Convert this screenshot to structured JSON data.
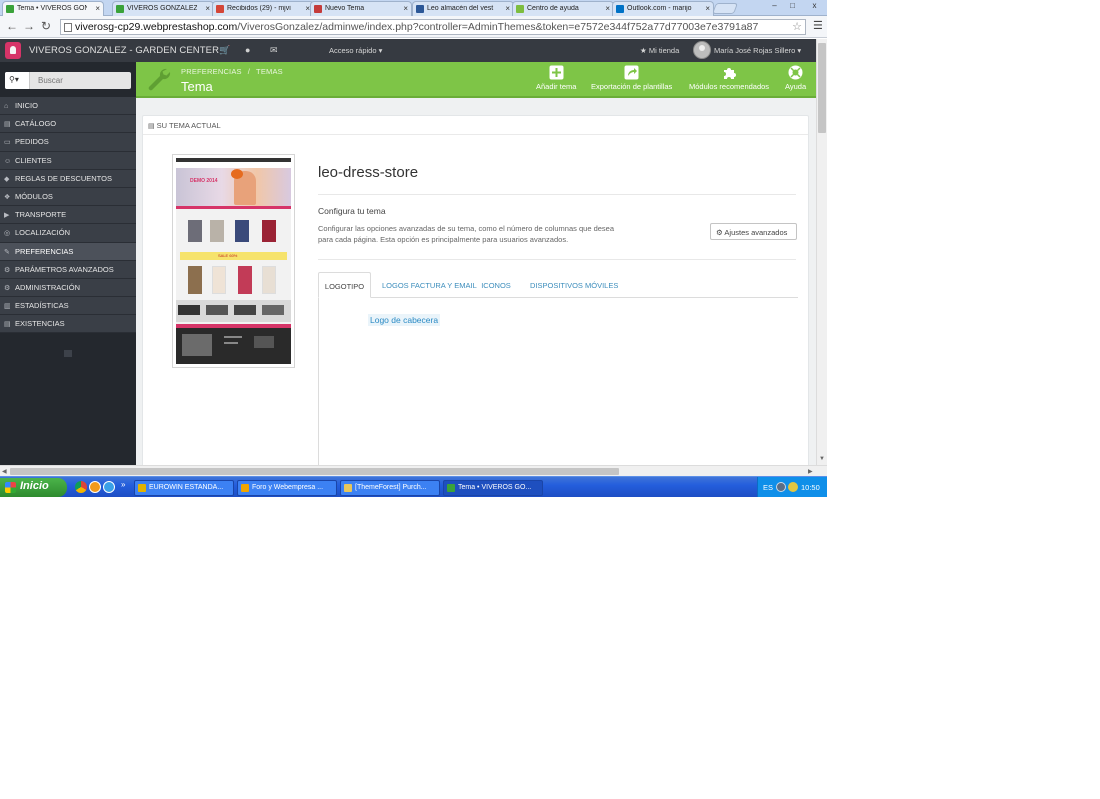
{
  "browser": {
    "tabs": [
      {
        "label": "Tema • VIVEROS GONZ",
        "color": "#3aa23a",
        "active": true
      },
      {
        "label": "VIVEROS GONZALEZ",
        "color": "#3aa23a",
        "active": false
      },
      {
        "label": "Recibidos (29) - mjvi",
        "color": "#d44638",
        "active": false
      },
      {
        "label": "Nuevo Tema",
        "color": "#c43b3b",
        "active": false
      },
      {
        "label": "Leo almacén del vest",
        "color": "#2b5797",
        "active": false
      },
      {
        "label": "Centro de ayuda",
        "color": "#7dbd3f",
        "active": false
      },
      {
        "label": "Outlook.com - marijo",
        "color": "#0072c6",
        "active": false
      }
    ],
    "url_host": "viverosg-cp29.webprestashop.com",
    "url_path": "/ViverosGonzalez/adminwe/index.php?controller=AdminThemes&token=e7572e344f752a77d77003e7e3791a87",
    "window_buttons": {
      "minimize": "–",
      "restore": "□",
      "close": "x"
    }
  },
  "topbar": {
    "shop_name": "VIVEROS GONZALEZ - GARDEN CENTER",
    "quick_access": "Acceso rápido",
    "my_shop": "Mi tienda",
    "user_name": "María José Rojas Sillero"
  },
  "sidebar": {
    "search_placeholder": "Buscar",
    "items": [
      {
        "label": "INICIO",
        "icon": "⌂"
      },
      {
        "label": "CATÁLOGO",
        "icon": "▤"
      },
      {
        "label": "PEDIDOS",
        "icon": "▭"
      },
      {
        "label": "CLIENTES",
        "icon": "☺"
      },
      {
        "label": "REGLAS DE DESCUENTOS",
        "icon": "◆"
      },
      {
        "label": "MÓDULOS",
        "icon": "❖"
      },
      {
        "label": "TRANSPORTE",
        "icon": "▶"
      },
      {
        "label": "LOCALIZACIÓN",
        "icon": "◎"
      },
      {
        "label": "PREFERENCIAS",
        "icon": "✎",
        "active": true
      },
      {
        "label": "PARÁMETROS AVANZADOS",
        "icon": "⚙"
      },
      {
        "label": "ADMINISTRACIÓN",
        "icon": "⚙"
      },
      {
        "label": "ESTADÍSTICAS",
        "icon": "▥"
      },
      {
        "label": "EXISTENCIAS",
        "icon": "▤"
      }
    ]
  },
  "pagehead": {
    "breadcrumb": [
      "PREFERENCIAS",
      "TEMAS"
    ],
    "title": "Tema",
    "toolbar": [
      {
        "label": "Añadir tema",
        "icon": "add-icon"
      },
      {
        "label": "Exportación de plantillas",
        "icon": "export-icon"
      },
      {
        "label": "Módulos recomendados",
        "icon": "puzzle-icon"
      },
      {
        "label": "Ayuda",
        "icon": "lifebuoy-icon"
      }
    ]
  },
  "panel": {
    "heading": "SU TEMA ACTUAL",
    "theme_name": "leo-dress-store",
    "configure_title": "Configura tu tema",
    "configure_desc": "Configurar las opciones avanzadas de su tema, como el número de columnas que desea para cada página. Esta opción es principalmente para usuarios avanzados.",
    "advanced_button": "Ajustes avanzados",
    "tabs": [
      "LOGOTIPO",
      "LOGOS FACTURA Y EMAIL",
      "ICONOS",
      "DISPOSITIVOS MÓVILES"
    ],
    "header_logo_label": "Logo de cabecera",
    "thumb_banner": "DEMO 2014",
    "thumb_sale": "SALE 60%"
  },
  "taskbar": {
    "start": "Inicio",
    "tasks": [
      {
        "label": "EUROWIN ESTANDA...",
        "color": "#e2b200"
      },
      {
        "label": "Foro y  Webempresa ...",
        "color": "#f0a500"
      },
      {
        "label": "[ThemeForest] Purch...",
        "color": "#e8c65a"
      },
      {
        "label": "Tema • VIVEROS GO...",
        "color": "#3aa23a",
        "active": true
      }
    ],
    "lang": "ES",
    "clock": "10:50"
  },
  "colors": {
    "green": "#7ec547",
    "dark": "#363a41",
    "link": "#3c8dbc"
  }
}
